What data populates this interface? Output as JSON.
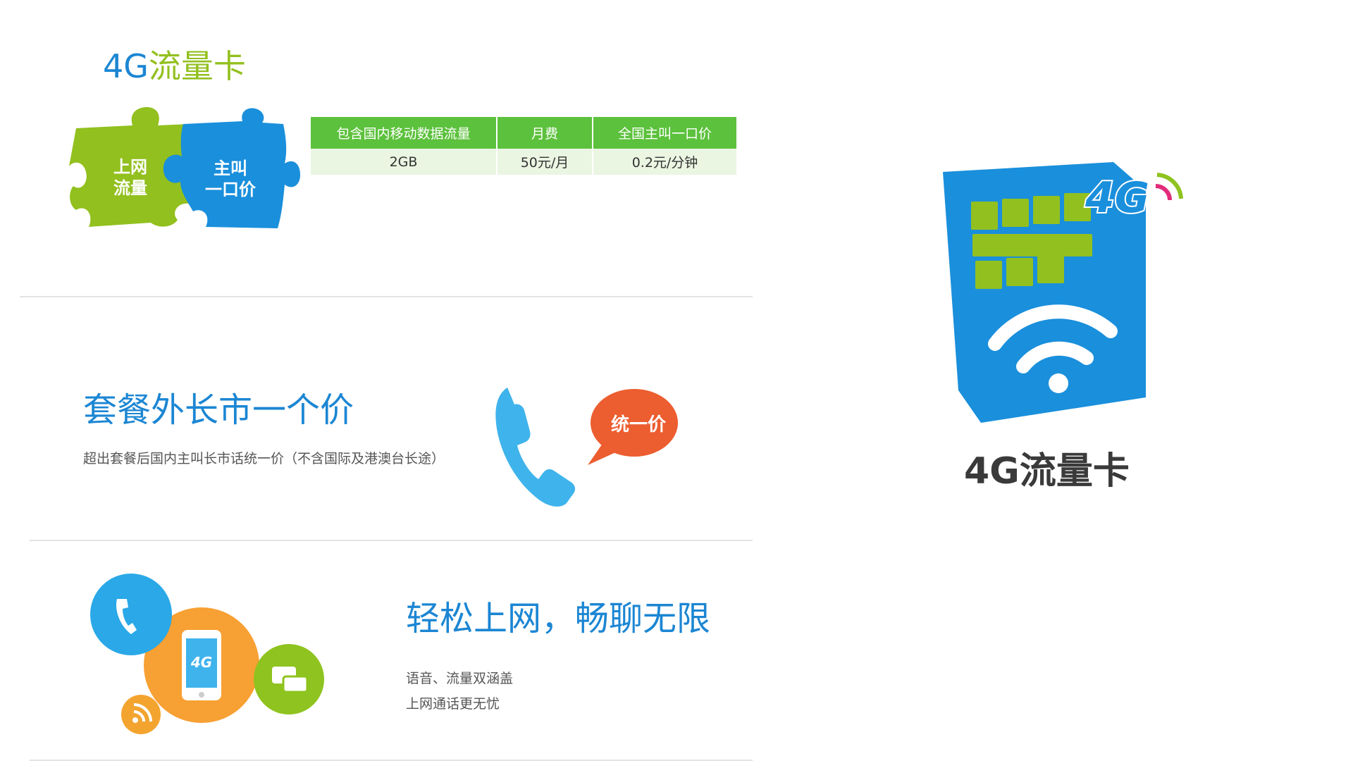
{
  "section_plan": {
    "title_prefix": "4G",
    "title_suffix": "流量卡",
    "puzzle_left": [
      "上网",
      "流量"
    ],
    "puzzle_right": [
      "主叫",
      "一口价"
    ],
    "table": {
      "headers": [
        "包含国内移动数据流量",
        "月费",
        "全国主叫一口价"
      ],
      "rows": [
        [
          "2GB",
          "50元/月",
          "0.2元/分钟"
        ]
      ]
    }
  },
  "section_call": {
    "headline": "套餐外长市一个价",
    "subtext": "超出套餐后国内主叫长市话统一价（不含国际及港澳台长途）",
    "bubble_label": "统一价"
  },
  "section_internet": {
    "headline": "轻松上网，畅聊无限",
    "lines": [
      "语音、流量双涵盖",
      "上网通话更无忧"
    ],
    "phone_screen_label": "4G"
  },
  "sim_icon": {
    "badge": "4G",
    "caption": "4G流量卡"
  },
  "colors": {
    "blue": "#1b86d3",
    "green": "#92c01e",
    "table_header": "#5cc13c",
    "orange": "#f0902a",
    "red_orange": "#ec5d2f"
  }
}
